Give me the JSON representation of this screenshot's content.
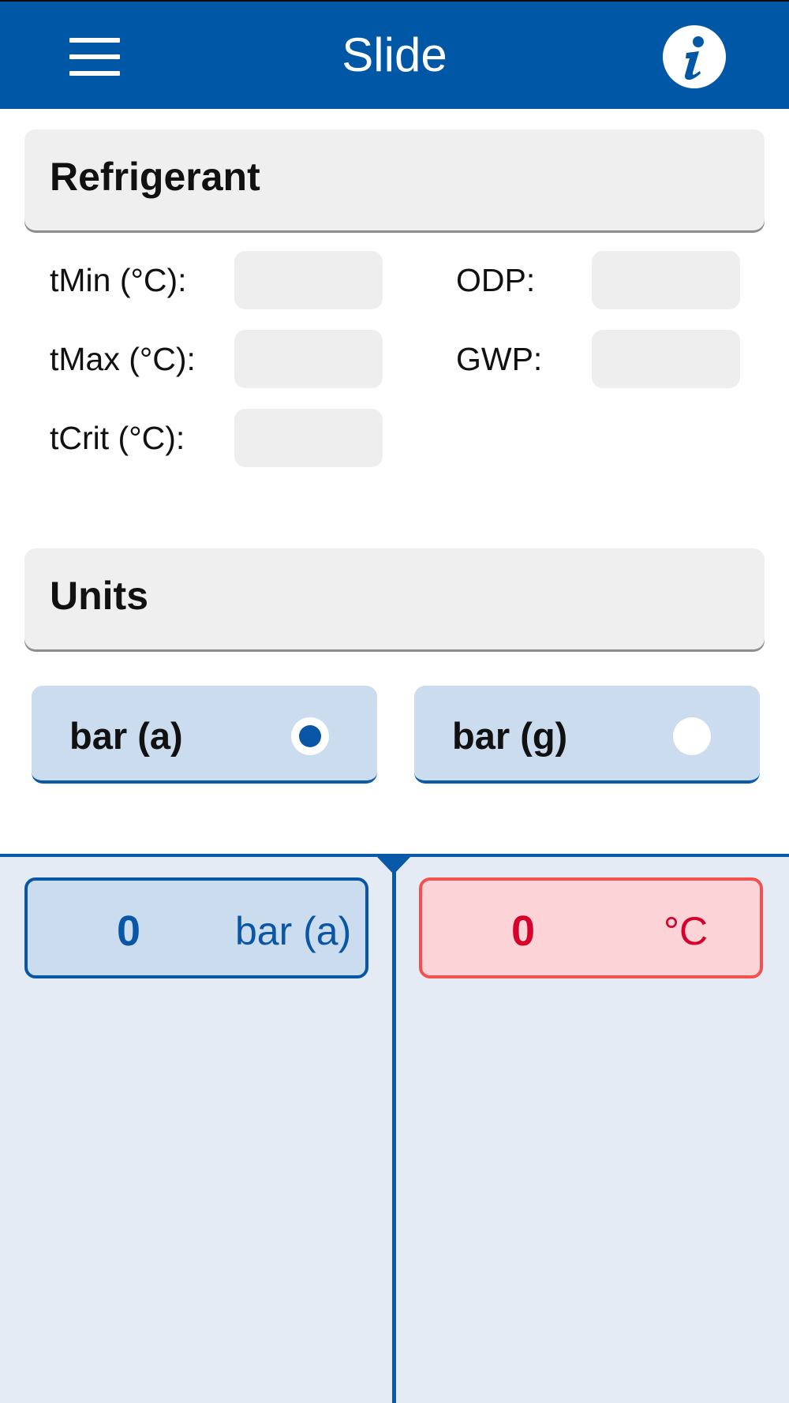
{
  "header": {
    "title": "Slide"
  },
  "colors": {
    "header_bg": "#0057a5",
    "accent": "#0a56a6",
    "temp_red": "#d6002a",
    "panel_bg": "#e4ebf4"
  },
  "icons": {
    "menu": "hamburger-menu-icon",
    "info": "info-icon"
  },
  "refrigerant": {
    "title": "Refrigerant",
    "fields": {
      "tmin": {
        "label": "tMin (°C):",
        "value": ""
      },
      "tmax": {
        "label": "tMax (°C):",
        "value": ""
      },
      "tcrit": {
        "label": "tCrit (°C):",
        "value": ""
      },
      "odp": {
        "label": "ODP:",
        "value": ""
      },
      "gwp": {
        "label": "GWP:",
        "value": ""
      }
    }
  },
  "units": {
    "title": "Units",
    "options": [
      {
        "label": "bar (a)",
        "selected": true
      },
      {
        "label": "bar (g)",
        "selected": false
      }
    ]
  },
  "slider": {
    "pressure": {
      "value": "0",
      "unit": "bar (a)"
    },
    "temperature": {
      "value": "0",
      "unit": "°C"
    }
  }
}
